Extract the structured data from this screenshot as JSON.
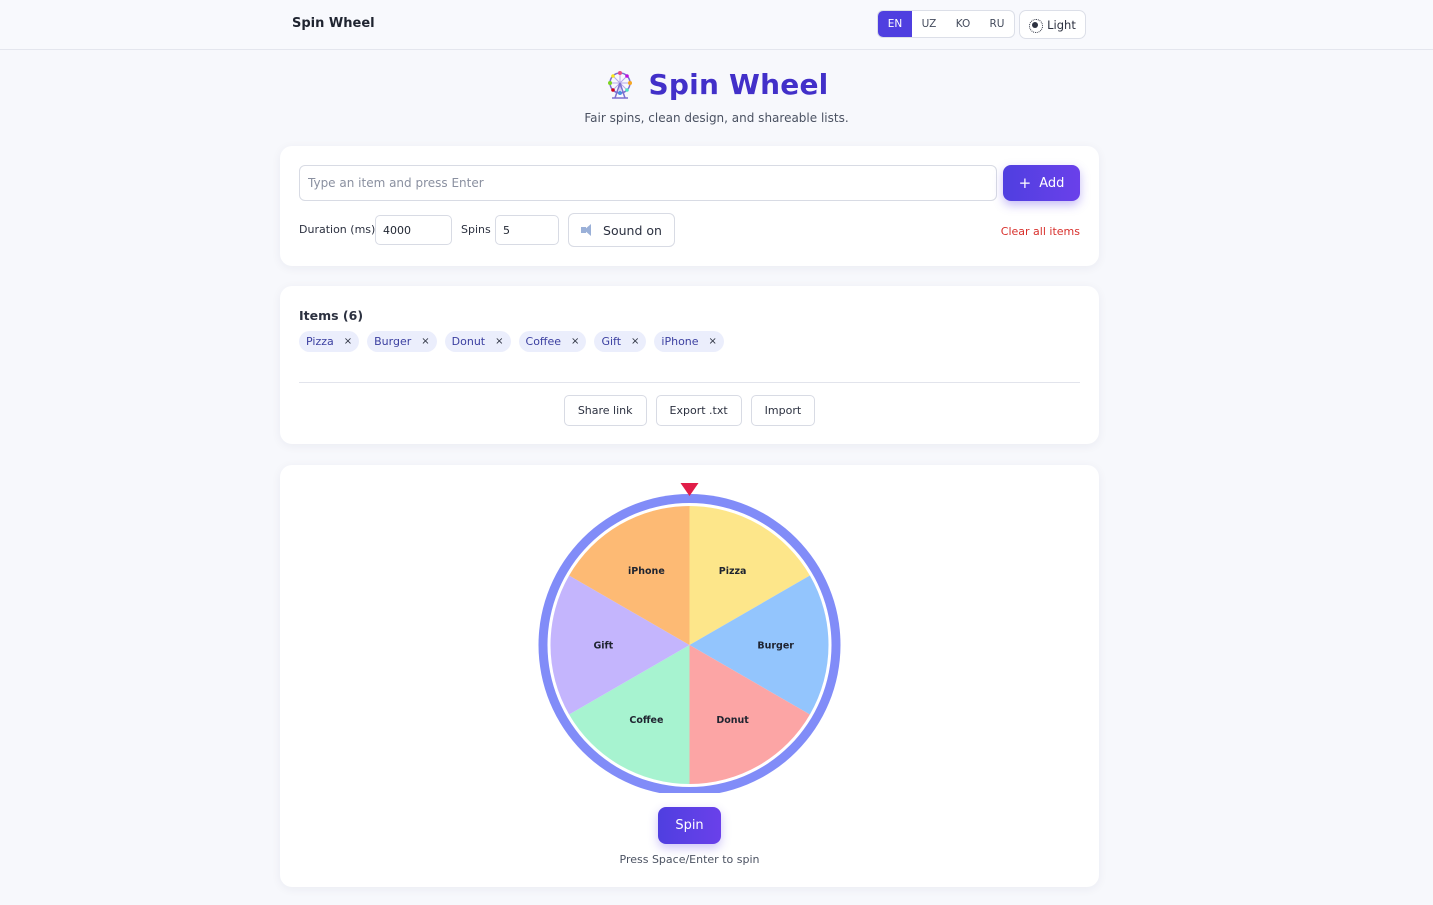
{
  "header": {
    "brand": "Spin Wheel",
    "languages": [
      "EN",
      "UZ",
      "KO",
      "RU"
    ],
    "active_language": "EN",
    "theme_label": "Light"
  },
  "hero": {
    "title": "Spin Wheel",
    "subtitle": "Fair spins, clean design, and shareable lists.",
    "icon": "ferris-wheel-emoji"
  },
  "controls": {
    "input_placeholder": "Type an item and press Enter",
    "add_label": "Add",
    "duration_label": "Duration (ms)",
    "duration_value": "4000",
    "spins_label": "Spins",
    "spins_value": "5",
    "sound_label": "Sound on",
    "clear_label": "Clear all items"
  },
  "items_panel": {
    "title": "Items (6)",
    "items": [
      "Pizza",
      "Burger",
      "Donut",
      "Coffee",
      "Gift",
      "iPhone"
    ],
    "remove_glyph": "×",
    "share_label": "Share link",
    "export_label": "Export .txt",
    "import_label": "Import"
  },
  "wheel": {
    "segments": [
      {
        "label": "Pizza",
        "color": "#fde68a"
      },
      {
        "label": "Burger",
        "color": "#93c5fd"
      },
      {
        "label": "Donut",
        "color": "#fca5a5"
      },
      {
        "label": "Coffee",
        "color": "#a7f3d0"
      },
      {
        "label": "Gift",
        "color": "#c4b5fd"
      },
      {
        "label": "iPhone",
        "color": "#fdba74"
      }
    ],
    "rim_color": "#818cf8",
    "pointer_color": "#e11d48",
    "spin_label": "Spin",
    "hint": "Press Space/Enter to spin"
  },
  "colors": {
    "accent": "#4f3fe0",
    "title": "#4230c9",
    "danger": "#d8302c",
    "chip_bg": "#ebeefc"
  }
}
